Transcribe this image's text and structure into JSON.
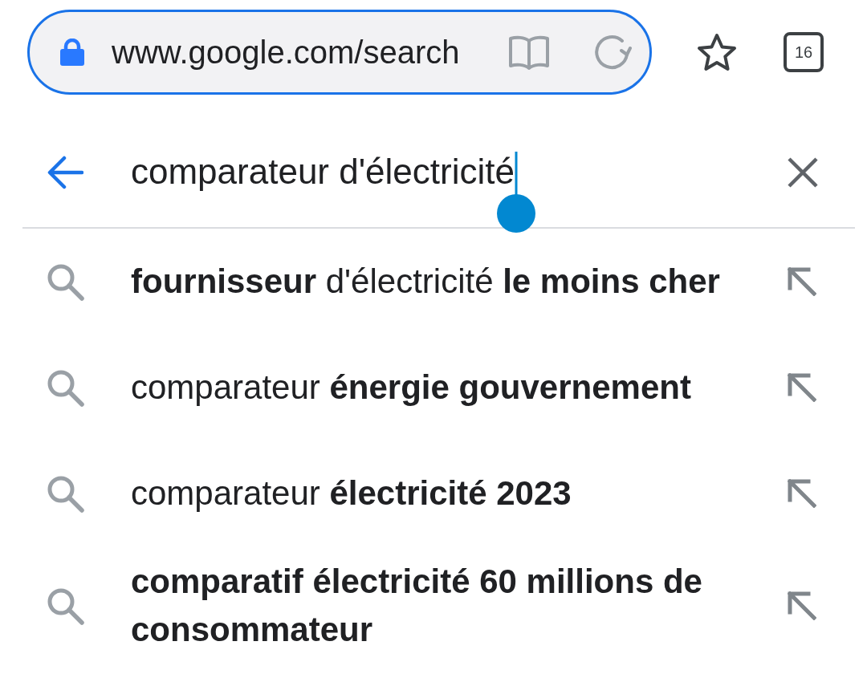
{
  "address_bar": {
    "url": "www.google.com/search",
    "focused": true
  },
  "tab_count": "16",
  "search": {
    "value": "comparateur d'électricité"
  },
  "suggestions": [
    {
      "text": "**fournisseur** d'électricité **le moins cher**"
    },
    {
      "text": "comparateur **énergie gouvernement**"
    },
    {
      "text": "comparateur **électricité 2023**"
    },
    {
      "text": "**comparatif électricité 60 millions de consommateur**"
    }
  ]
}
